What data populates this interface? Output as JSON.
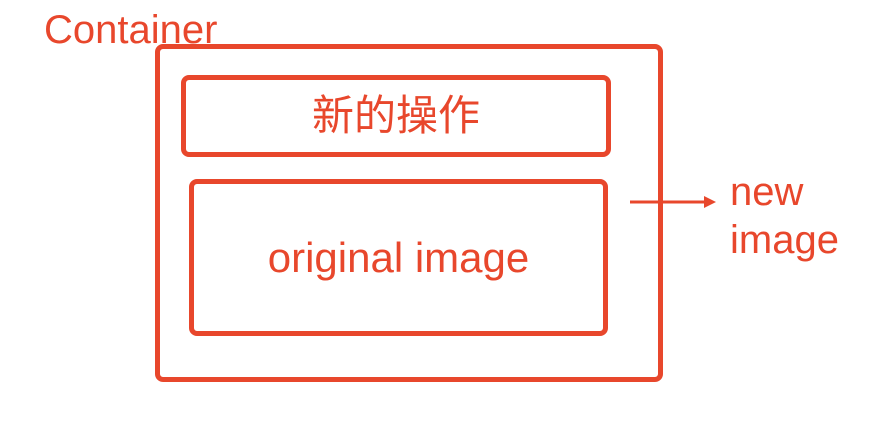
{
  "container": {
    "label": "Container"
  },
  "operations_box": {
    "label": "新的操作"
  },
  "original_box": {
    "label": "original image"
  },
  "output": {
    "line1": "new",
    "line2": "image"
  },
  "colors": {
    "accent": "#e8472c",
    "background": "#ffffff"
  }
}
